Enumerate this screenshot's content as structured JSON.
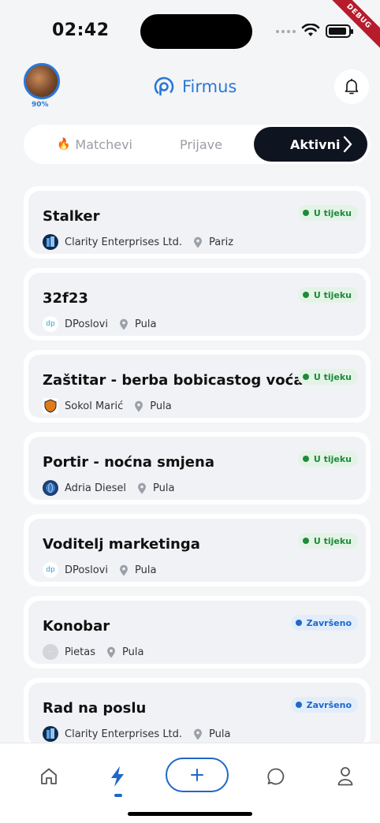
{
  "status_bar": {
    "time": "02:42",
    "debug_label": "DEBUG"
  },
  "header": {
    "profile_completion": "90%",
    "app_name": "Firmus"
  },
  "tabs": [
    {
      "label": "Matchevi",
      "active": false
    },
    {
      "label": "Prijave",
      "active": false
    },
    {
      "label": "Aktivni",
      "active": true
    }
  ],
  "jobs": [
    {
      "title": "Stalker",
      "company": "Clarity Enterprises Ltd.",
      "location": "Pariz",
      "status": "U tijeku",
      "status_color": "#1e8a3a",
      "logo_icon": "building-logo"
    },
    {
      "title": "32f23",
      "company": "DPoslovi",
      "location": "Pula",
      "status": "U tijeku",
      "status_color": "#1e8a3a",
      "logo_icon": "dp-logo"
    },
    {
      "title": "Zaštitar - berba bobicastog voća",
      "company": "Sokol Marić",
      "location": "Pula",
      "status": "U tijeku",
      "status_color": "#1e8a3a",
      "logo_icon": "shield-logo"
    },
    {
      "title": "Portir - noćna smjena",
      "company": "Adria Diesel",
      "location": "Pula",
      "status": "U tijeku",
      "status_color": "#1e8a3a",
      "logo_icon": "globe-logo"
    },
    {
      "title": "Voditelj marketinga",
      "company": "DPoslovi",
      "location": "Pula",
      "status": "U tijeku",
      "status_color": "#1e8a3a",
      "logo_icon": "dp-logo"
    },
    {
      "title": "Konobar",
      "company": "Pietas",
      "location": "Pula",
      "status": "Završeno",
      "status_color": "#1f67c8",
      "logo_icon": "placeholder-logo"
    },
    {
      "title": "Rad na poslu",
      "company": "Clarity Enterprises Ltd.",
      "location": "Pula",
      "status": "Završeno",
      "status_color": "#1f67c8",
      "logo_icon": "building-logo"
    }
  ],
  "bottom_nav": [
    {
      "icon": "home-icon"
    },
    {
      "icon": "bolt-icon",
      "active": true
    },
    {
      "icon": "plus-icon"
    },
    {
      "icon": "chat-icon"
    },
    {
      "icon": "profile-icon"
    }
  ],
  "colors": {
    "accent": "#1f67c8",
    "dark": "#0e1420",
    "in_progress": "#1e8a3a",
    "finished": "#1f67c8"
  }
}
